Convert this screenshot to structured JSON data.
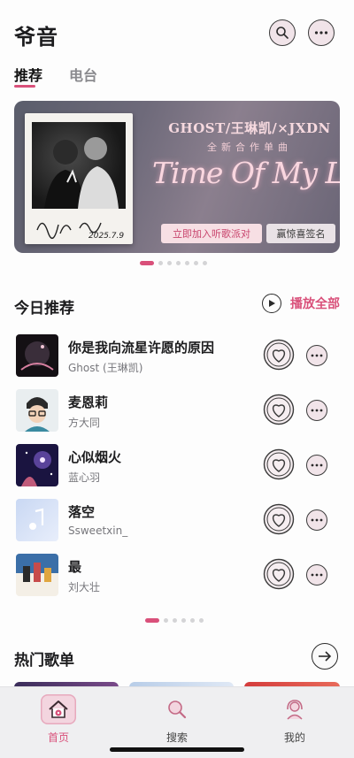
{
  "app": {
    "title": "爷音"
  },
  "header": {
    "search_icon": "search-icon",
    "more_icon": "more-icon"
  },
  "tabs": [
    {
      "label": "推荐",
      "active": true
    },
    {
      "label": "电台",
      "active": false
    }
  ],
  "banner": {
    "artist_line": "GHOST/王琳凯/×JXDN",
    "subtitle": "全新合作单曲",
    "song_title": "Time Of My Life",
    "cta_primary": "立即加入听歌派对",
    "cta_secondary": "赢惊喜签名",
    "signature_date": "2025.7.9",
    "dots_total": 7,
    "dots_active": 0
  },
  "today": {
    "title": "今日推荐",
    "play_all_label": "播放全部",
    "songs": [
      {
        "title": "你是我向流星许愿的原因",
        "artist": "Ghost (王琳凯)"
      },
      {
        "title": "麦恩莉",
        "artist": "方大同"
      },
      {
        "title": "心似烟火",
        "artist": "蓝心羽"
      },
      {
        "title": "落空",
        "artist": "Ssweetxin_"
      },
      {
        "title": "最",
        "artist": "刘大壮"
      }
    ],
    "dots_total": 6,
    "dots_active": 0
  },
  "hot_playlists": {
    "title": "热门歌单"
  },
  "tabbar": [
    {
      "label": "首页",
      "icon": "home-icon",
      "active": true
    },
    {
      "label": "搜索",
      "icon": "search-icon",
      "active": false
    },
    {
      "label": "我的",
      "icon": "profile-icon",
      "active": false
    }
  ],
  "colors": {
    "accent": "#d9507a",
    "button_fill": "#f1e4e9",
    "tabbar_bg": "#efeff1"
  }
}
